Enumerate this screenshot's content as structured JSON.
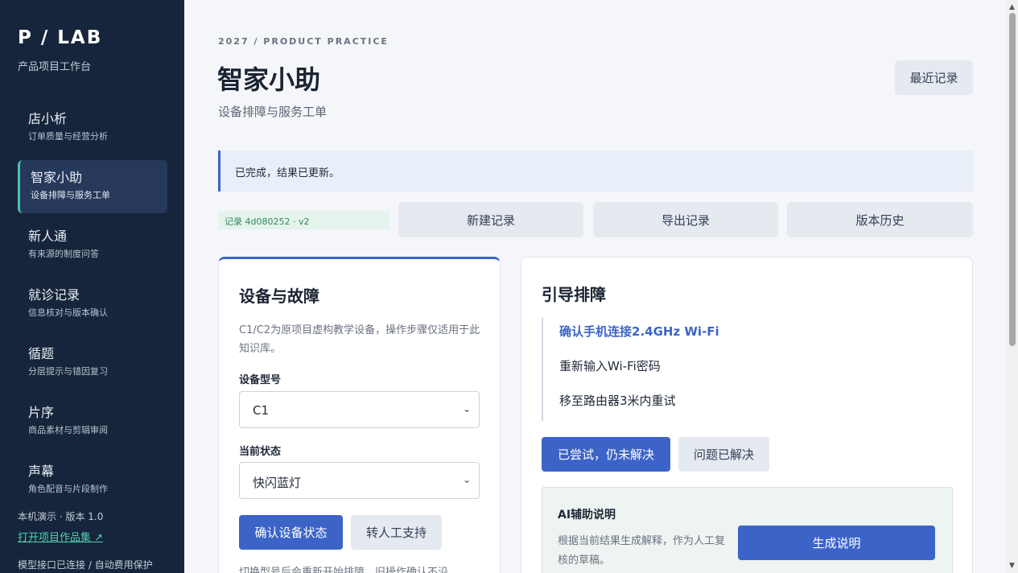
{
  "sidebar": {
    "brand": "P / LAB",
    "brand_sub": "产品项目工作台",
    "items": [
      {
        "title": "店小析",
        "sub": "订单质量与经营分析"
      },
      {
        "title": "智家小助",
        "sub": "设备排障与服务工单"
      },
      {
        "title": "新人通",
        "sub": "有来源的制度问答"
      },
      {
        "title": "就诊记录",
        "sub": "信息核对与版本确认"
      },
      {
        "title": "循题",
        "sub": "分层提示与错因复习"
      },
      {
        "title": "片序",
        "sub": "商品素材与剪辑审阅"
      },
      {
        "title": "声幕",
        "sub": "角色配音与片段制作"
      }
    ],
    "footer": "本机演示 · 版本 1.0",
    "link": "打开项目作品集 ↗",
    "status": "模型接口已连接 / 自动费用保护"
  },
  "header": {
    "eyebrow": "2027 / PRODUCT PRACTICE",
    "title": "智家小助",
    "subtitle": "设备排障与服务工单",
    "recent_label": "最近记录"
  },
  "notice": "已完成，结果已更新。",
  "toolbar": {
    "record_tag": "记录 4d080252 · v2",
    "new_label": "新建记录",
    "export_label": "导出记录",
    "history_label": "版本历史"
  },
  "device_card": {
    "title": "设备与故障",
    "desc": "C1/C2为原项目虚构教学设备，操作步骤仅适用于此知识库。",
    "model_label": "设备型号",
    "model_value": "C1",
    "state_label": "当前状态",
    "state_value": "快闪蓝灯",
    "confirm_label": "确认设备状态",
    "human_label": "转人工支持",
    "note": "切换型号后会重新开始排障，旧操作确认不沿"
  },
  "guide_card": {
    "title": "引导排障",
    "steps": [
      "确认手机连接2.4GHz Wi-Fi",
      "重新输入Wi-Fi密码",
      "移至路由器3米内重试"
    ],
    "tried_label": "已尝试，仍未解决",
    "solved_label": "问题已解决",
    "ai": {
      "title": "AI辅助说明",
      "desc": "根据当前结果生成解释，作为人工复核的草稿。",
      "button_label": "生成说明"
    }
  },
  "colors": {
    "sidebar_bg": "#16253b",
    "accent": "#3c64c8",
    "active_marker": "#49c2a6",
    "link": "#4fd1b0"
  }
}
